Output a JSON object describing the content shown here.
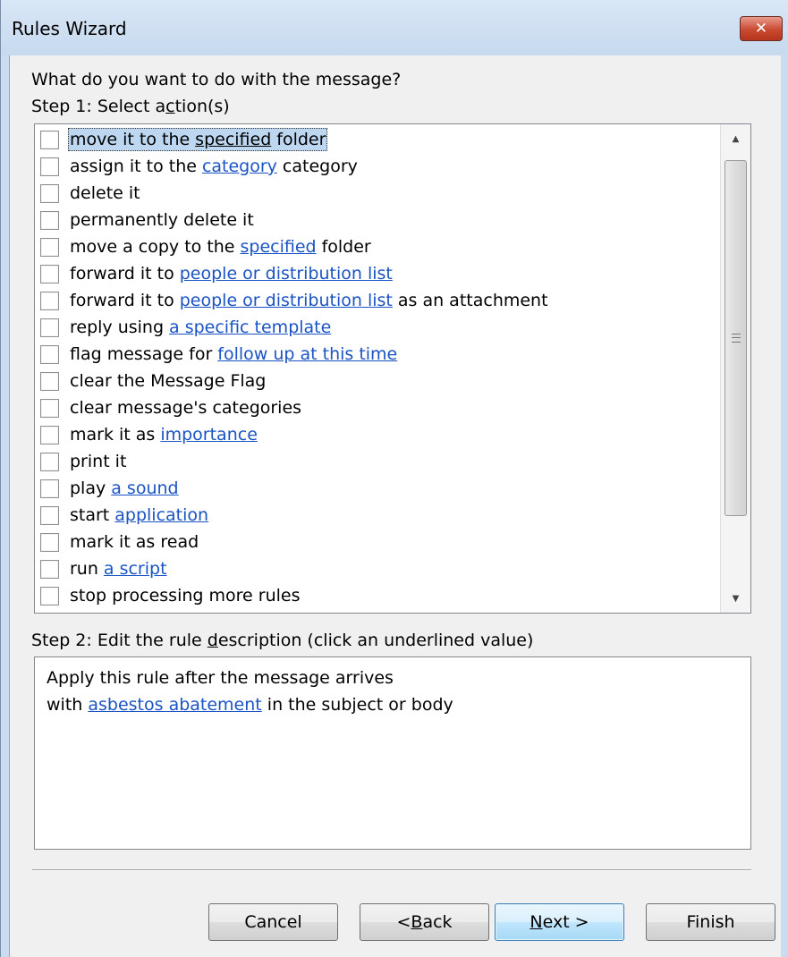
{
  "window": {
    "title": "Rules Wizard",
    "close_glyph": "✕"
  },
  "question": "What do you want to do with the message?",
  "step1": {
    "label_pre": "Step 1: Select a",
    "label_ul": "c",
    "label_post": "tion(s)"
  },
  "actions": [
    {
      "parts": [
        {
          "t": "move it to the",
          "k": "text"
        },
        {
          "t": "specified",
          "k": "underline"
        },
        {
          "t": "folder",
          "k": "text"
        }
      ],
      "selected": true
    },
    {
      "parts": [
        {
          "t": "assign it to the",
          "k": "text"
        },
        {
          "t": "category",
          "k": "link"
        },
        {
          "t": "category",
          "k": "text"
        }
      ]
    },
    {
      "parts": [
        {
          "t": "delete it",
          "k": "text"
        }
      ]
    },
    {
      "parts": [
        {
          "t": "permanently delete it",
          "k": "text"
        }
      ]
    },
    {
      "parts": [
        {
          "t": "move a copy to the",
          "k": "text"
        },
        {
          "t": "specified",
          "k": "link"
        },
        {
          "t": "folder",
          "k": "text"
        }
      ]
    },
    {
      "parts": [
        {
          "t": "forward it to",
          "k": "text"
        },
        {
          "t": "people or distribution list",
          "k": "link"
        }
      ]
    },
    {
      "parts": [
        {
          "t": "forward it to",
          "k": "text"
        },
        {
          "t": "people or distribution list",
          "k": "link"
        },
        {
          "t": "as an attachment",
          "k": "text"
        }
      ]
    },
    {
      "parts": [
        {
          "t": "reply using",
          "k": "text"
        },
        {
          "t": "a specific template",
          "k": "link"
        }
      ]
    },
    {
      "parts": [
        {
          "t": "flag message for",
          "k": "text"
        },
        {
          "t": "follow up at this time",
          "k": "link"
        }
      ]
    },
    {
      "parts": [
        {
          "t": "clear the Message Flag",
          "k": "text"
        }
      ]
    },
    {
      "parts": [
        {
          "t": "clear message's categories",
          "k": "text"
        }
      ]
    },
    {
      "parts": [
        {
          "t": "mark it as",
          "k": "text"
        },
        {
          "t": "importance",
          "k": "link"
        }
      ]
    },
    {
      "parts": [
        {
          "t": "print it",
          "k": "text"
        }
      ]
    },
    {
      "parts": [
        {
          "t": "play",
          "k": "text"
        },
        {
          "t": "a sound",
          "k": "link"
        }
      ]
    },
    {
      "parts": [
        {
          "t": "start",
          "k": "text"
        },
        {
          "t": "application",
          "k": "link"
        }
      ]
    },
    {
      "parts": [
        {
          "t": "mark it as read",
          "k": "text"
        }
      ]
    },
    {
      "parts": [
        {
          "t": "run",
          "k": "text"
        },
        {
          "t": "a script",
          "k": "link"
        }
      ]
    },
    {
      "parts": [
        {
          "t": "stop processing more rules",
          "k": "text"
        }
      ]
    }
  ],
  "scrollbar": {
    "up_glyph": "▲",
    "down_glyph": "▼",
    "position": 0
  },
  "step2": {
    "label_pre": "Step 2: Edit the rule ",
    "label_ul": "d",
    "label_post": "escription (click an underlined value)"
  },
  "description": {
    "line1": "Apply this rule after the message arrives",
    "line2_pre": "with",
    "line2_link": "asbestos abatement",
    "line2_post": "in the subject or body"
  },
  "buttons": {
    "cancel": "Cancel",
    "back_pre": "< ",
    "back_ul": "B",
    "back_post": "ack",
    "next_ul": "N",
    "next_post": "ext >",
    "finish": "Finish"
  },
  "colors": {
    "link": "#1a54c4",
    "selection": "#bdd7f1",
    "close_button": "#c94a31"
  }
}
